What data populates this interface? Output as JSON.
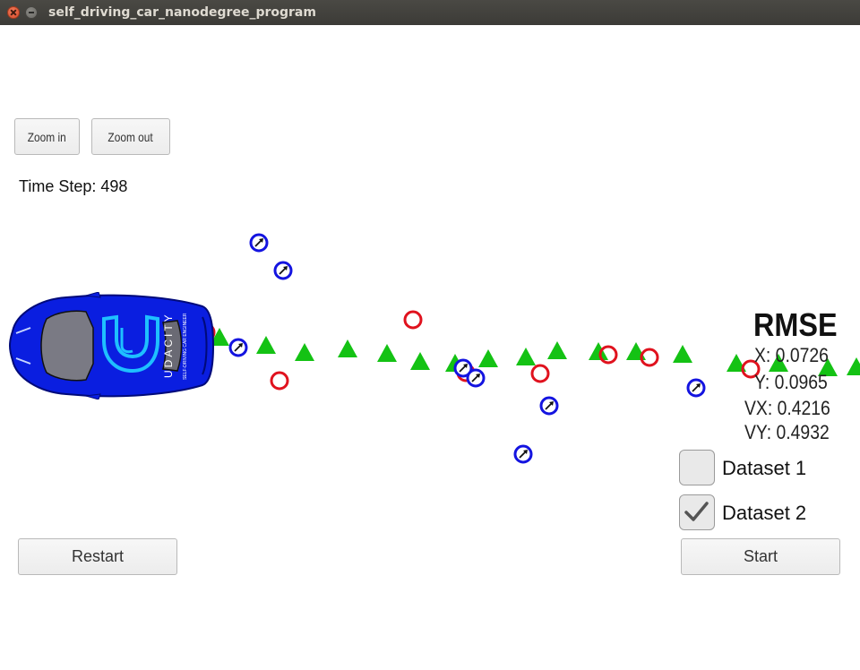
{
  "window": {
    "title": "self_driving_car_nanodegree_program"
  },
  "controls": {
    "zoom_in_label": "Zoom in",
    "zoom_out_label": "Zoom out",
    "restart_label": "Restart",
    "start_label": "Start"
  },
  "status": {
    "time_step_text": "Time Step: 498"
  },
  "rmse": {
    "title": "RMSE",
    "x_text": "X: 0.0726",
    "y_text": "Y: 0.0965",
    "vx_text": "VX: 0.4216",
    "vy_text": "VY: 0.4932"
  },
  "datasets": [
    {
      "label": "Dataset 1",
      "checked": false
    },
    {
      "label": "Dataset 2",
      "checked": true
    }
  ],
  "car": {
    "brand_text": "UDACITY",
    "sub_text": "SELF-DRIVING CAR ENGINEER",
    "color": "#0a1ee0"
  },
  "colors": {
    "lidar": "#e0121e",
    "radar": "#1414e0",
    "estimate": "#14c214",
    "titlebar": "#3c3b37"
  },
  "icons": {
    "checkmark": "check-icon",
    "lidar_marker": "circle-icon",
    "radar_marker": "circle-arrow-icon",
    "estimate_marker": "triangle-icon"
  }
}
